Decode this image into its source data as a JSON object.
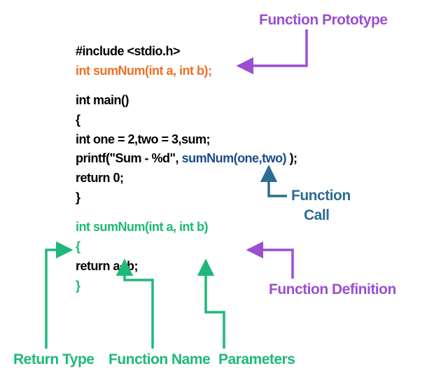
{
  "code": {
    "l1": "#include <stdio.h>",
    "l2": "int sumNum(int a, int b);",
    "l3": "int main()",
    "l4": "{",
    "l5": "   int one = 2,two = 3,sum;",
    "l6_a": "   printf(\"Sum - %d\", ",
    "l6_b": "sumNum(one,two)",
    "l6_c": " );",
    "l7": "   return 0;",
    "l8": "}",
    "l9": "int sumNum(int a, int b)",
    "l10": "{",
    "l11": "   return a+b;",
    "l12": "}"
  },
  "labels": {
    "prototype": "Function Prototype",
    "call_a": "Function",
    "call_b": "Call",
    "definition": "Function Definition",
    "return_type": "Return Type",
    "function_name": "Function Name",
    "parameters": "Parameters"
  },
  "colors": {
    "purple": "#9b4fcf",
    "teal": "#2b6d91",
    "green": "#1fb87a",
    "orange": "#ee7125",
    "blue": "#1b4c8a"
  }
}
